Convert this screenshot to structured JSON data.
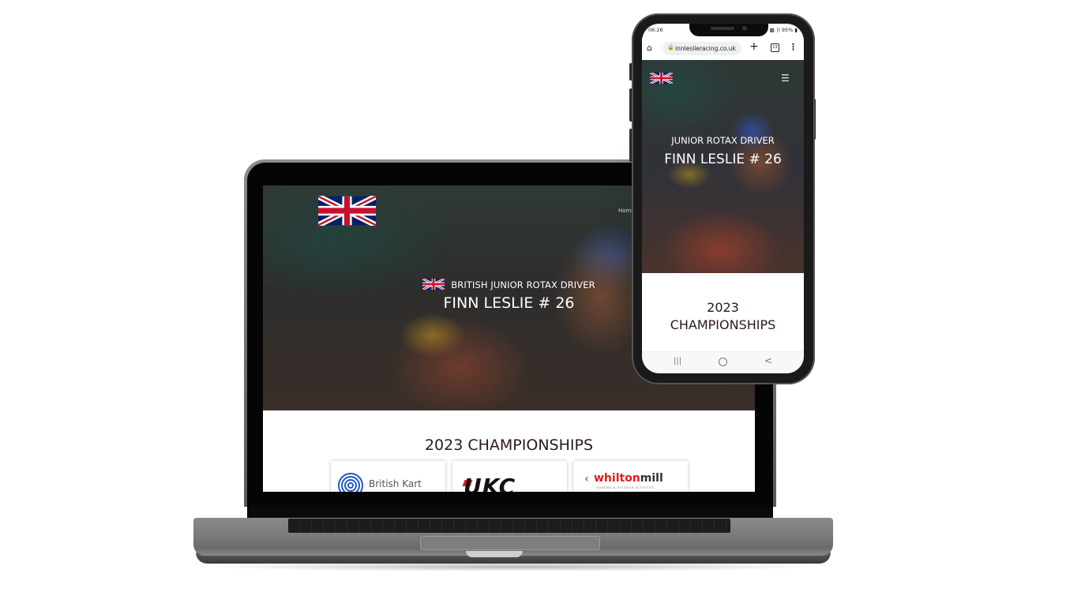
{
  "desktop_site": {
    "nav": {
      "home_label": "Home"
    },
    "hero": {
      "subtitle": "BRITISH JUNIOR ROTAX DRIVER",
      "title": "FINN LESLIE # 26",
      "flag_icon": "union-jack-flag"
    },
    "championships": {
      "heading": "2023 CHAMPIONSHIPS",
      "logos": [
        {
          "name": "British Kart Championships",
          "text": "British Kart"
        },
        {
          "name": "UKC",
          "text": "UKC"
        },
        {
          "name": "Whilton Mill",
          "text_a": "whilton",
          "text_b": "mill",
          "tagline": "KARTING & OUTDOOR ACTIVITIES"
        }
      ]
    }
  },
  "mobile_site": {
    "status_bar": {
      "time": "06:26",
      "battery": "95%",
      "signal": "‡‡ .∩l 95%"
    },
    "browser": {
      "url": "innleslieracing.co.uk",
      "tab_count": "13"
    },
    "hero": {
      "subtitle": "JUNIOR ROTAX DRIVER",
      "title": "FINN LESLIE # 26"
    },
    "championships": {
      "heading_line1": "2023",
      "heading_line2": "CHAMPIONSHIPS"
    },
    "nav_bar": {
      "recents": "|||",
      "back": "<"
    }
  },
  "colors": {
    "flag_blue": "#012169",
    "flag_red": "#C8102E",
    "heading_text": "#2a1a1a",
    "brand_red": "#e21b23"
  }
}
